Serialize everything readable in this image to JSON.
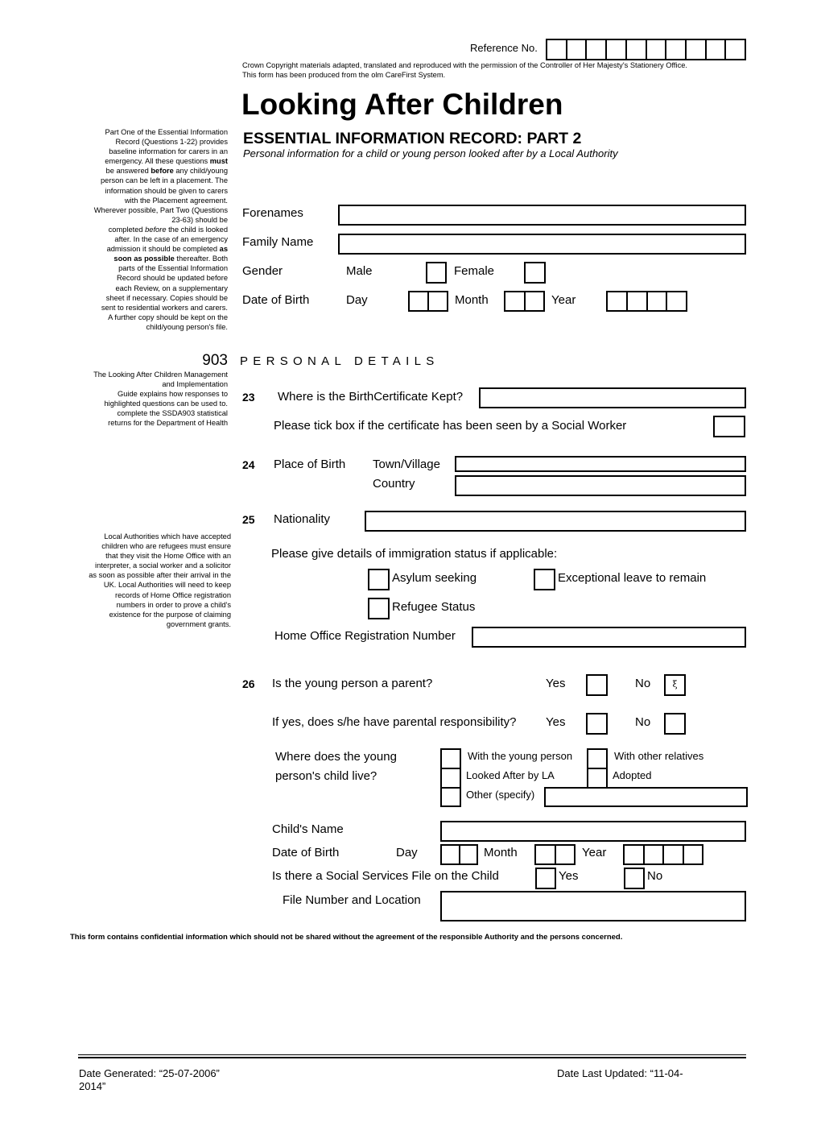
{
  "header": {
    "reference_label": "Reference No.",
    "reference_cells": 10,
    "copyright_line1": "Crown Copyright materials adapted, translated and reproduced with the permission of the Controller of Her Majesty's Stationery Office.",
    "copyright_line2": "This form has been produced from the olm CareFirst System.",
    "title": "Looking After Children",
    "subtitle": "ESSENTIAL INFORMATION RECORD: PART 2",
    "description": "Personal information for a child or young person looked after by a Local Authority"
  },
  "sidebar": {
    "intro": {
      "l1": "Part One of the Essential Information",
      "l2": "Record (Questions 1-22) provides",
      "l3": "baseline information for carers in an",
      "l4a": "emergency.  All these questions ",
      "l4b": "must",
      "l5a": "be answered ",
      "l5b": "before",
      "l5c": " any child/young",
      "l6": "person can be left in a placement.  The",
      "l7": "information should be given to carers",
      "l8": "with the Placement agreement.",
      "l9": "Wherever possible, Part Two (Questions",
      "l10": "23-63) should be",
      "l11a": "completed ",
      "l11b": "before",
      "l11c": " the child is looked",
      "l12": "after. In the case of an emergency",
      "l13a": "admission it should be completed ",
      "l13b": "as",
      "l14a": "soon as possible",
      "l14b": " thereafter. Both",
      "l15": "parts of the Essential Information",
      "l16": "Record should be updated before",
      "l17": "each Review, on a supplementary",
      "l18": "sheet if necessary. Copies should be",
      "l19": "sent to residential workers and carers.",
      "l20": "A further copy should be kept on the",
      "l21": "child/young person's file."
    },
    "ssda": {
      "code": "903",
      "l1": "The Looking After Children Management",
      "l2": "and Implementation",
      "l3": "Guide explains how responses to",
      "l4": "highlighted questions can be used to.",
      "l5": "complete the SSDA903 statistical",
      "l6": "returns for the Department of Health"
    },
    "refugee": {
      "l1": "Local Authorities which have accepted",
      "l2": "children who are refugees must ensure",
      "l3": "that they visit the Home Office with an",
      "l4": "interpreter, a social worker and a solicitor",
      "l5": "as soon as possible after their arrival in the",
      "l6": "UK.  Local Authorities will need to keep",
      "l7": "records of Home Office registration",
      "l8": "numbers in order to prove a child's",
      "l9": "existence for the purpose of claiming",
      "l10": "government grants."
    }
  },
  "identity": {
    "forenames_label": "Forenames",
    "forenames_value": "",
    "family_name_label": "Family Name",
    "family_name_value": "",
    "gender_label": "Gender",
    "male_label": "Male",
    "female_label": "Female",
    "male_checked": false,
    "female_checked": false,
    "dob_label": "Date of Birth",
    "day_label": "Day",
    "month_label": "Month",
    "year_label": "Year"
  },
  "section": {
    "code": "903",
    "title": "PERSONAL DETAILS"
  },
  "q23": {
    "num": "23",
    "question": "Where is the BirthCertificate Kept?",
    "value": "",
    "tick_label": "Please tick box if the certificate has been seen by a Social Worker",
    "tick_checked": false
  },
  "q24": {
    "num": "24",
    "label": "Place of Birth",
    "town_label": "Town/Village",
    "town_value": "",
    "country_label": "Country",
    "country_value": ""
  },
  "q25": {
    "num": "25",
    "label": "Nationality",
    "value": "",
    "immigration_label": "Please give details of immigration status if applicable:",
    "asylum_label": "Asylum seeking",
    "exceptional_label": "Exceptional leave to remain",
    "refugee_label": "Refugee Status",
    "home_office_label": "Home Office Registration Number",
    "home_office_value": ""
  },
  "q26": {
    "num": "26",
    "parent_question": "Is the young person a parent?",
    "yes_label": "Yes",
    "no_label": "No",
    "parent_no_mark": "ξ",
    "responsibility_question": "If yes, does s/he have parental responsibility?",
    "child_live_l1": "Where does the young",
    "child_live_l2": "person's child live?",
    "opt_with_young_person": "With the young person",
    "opt_with_relatives": "With other relatives",
    "opt_looked_after": "Looked After by LA",
    "opt_adopted": "Adopted",
    "opt_other": "Other (specify)",
    "other_value": "",
    "child_name_label": "Child's Name",
    "child_name_value": "",
    "child_dob_label": "Date of Birth",
    "day_label": "Day",
    "month_label": "Month",
    "year_label": "Year",
    "ss_file_label": "Is there a Social Services File on the Child",
    "ss_yes": "Yes",
    "ss_no": "No",
    "file_number_label": "File Number and Location",
    "file_number_value": ""
  },
  "footer": {
    "confidential": "This form contains confidential information which should not be shared without the agreement of the responsible Authority and the persons concerned.",
    "date_generated": "Date Generated:  “25-07-2006”",
    "date_updated_part1": "Date Last Updated:  “11-04-",
    "date_updated_part2": "2014”"
  }
}
